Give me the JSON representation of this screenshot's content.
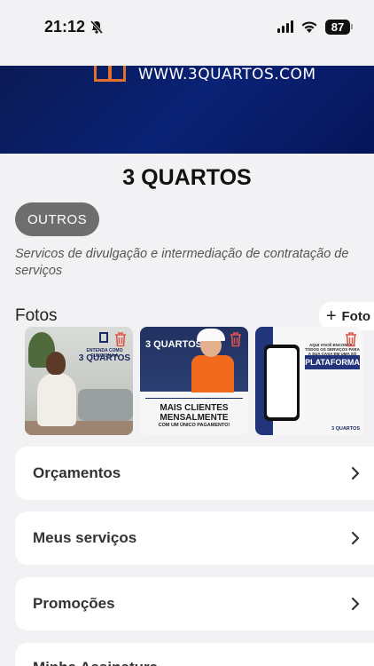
{
  "status_bar": {
    "time": "21:12",
    "battery": "87"
  },
  "banner": {
    "url_text": "WWW.3QUARTOS.COM"
  },
  "profile": {
    "name": "3 QUARTOS",
    "category": "OUTROS",
    "description": "Servicos de divulgação e intermediação de contratação de serviços"
  },
  "photos": {
    "title": "Fotos",
    "add_label": "Foto",
    "items": [
      {
        "caption_small": "ENTENDA COMO FUNCIONA A",
        "caption_large": "3 QUARTOS"
      },
      {
        "brand": "3 QUARTOS",
        "caption_large": "MAIS CLIENTES MENSALMENTE",
        "caption_small": "COM UM ÚNICO PAGAMENTO!"
      },
      {
        "caption_small": "AQUI VOCÊ ENCONTRA TODOS OS SERVIÇOS PARA A SUA CASA EM UMA SÓ",
        "caption_large": "PLATAFORMA",
        "footer": "3 QUARTOS"
      }
    ]
  },
  "menu": {
    "items": [
      {
        "label": "Orçamentos"
      },
      {
        "label": "Meus serviços"
      },
      {
        "label": "Promoções"
      },
      {
        "label": "Minha Assinatura"
      }
    ]
  },
  "colors": {
    "accent_orange": "#e0712b",
    "brand_blue": "#0a2275",
    "delete_red": "#e0554a"
  }
}
